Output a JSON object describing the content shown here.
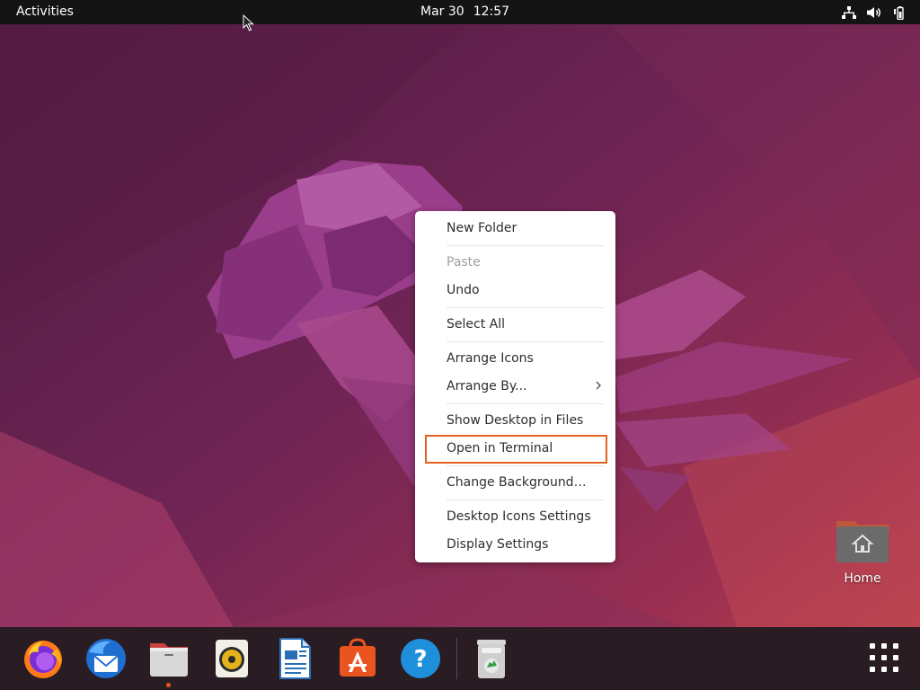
{
  "topbar": {
    "activities_label": "Activities",
    "date": "Mar 30",
    "time": "12:57",
    "tray_icons": [
      "network-icon",
      "volume-icon",
      "battery-icon"
    ]
  },
  "context_menu": {
    "items": [
      {
        "label": "New Folder",
        "enabled": true
      },
      {
        "label": "Paste",
        "enabled": false
      },
      {
        "label": "Undo",
        "enabled": true
      },
      {
        "label": "Select All",
        "enabled": true
      },
      {
        "label": "Arrange Icons",
        "enabled": true
      },
      {
        "label": "Arrange By...",
        "enabled": true,
        "submenu": true
      },
      {
        "label": "Show Desktop in Files",
        "enabled": true
      },
      {
        "label": "Open in Terminal",
        "enabled": true,
        "highlighted": true
      },
      {
        "label": "Change Background…",
        "enabled": true
      },
      {
        "label": "Desktop Icons Settings",
        "enabled": true
      },
      {
        "label": "Display Settings",
        "enabled": true
      }
    ]
  },
  "desktop": {
    "home_label": "Home"
  },
  "dock": {
    "apps": [
      "firefox-icon",
      "thunderbird-icon",
      "files-icon",
      "rhythmbox-icon",
      "libreoffice-writer-icon",
      "software-icon",
      "help-icon",
      "trash-icon",
      "show-apps-icon"
    ],
    "running_app": "files-icon"
  },
  "colors": {
    "accent": "#e95420",
    "highlight_border": "#e2621d",
    "topbar": "#141414",
    "dock": "#2a1c23"
  }
}
